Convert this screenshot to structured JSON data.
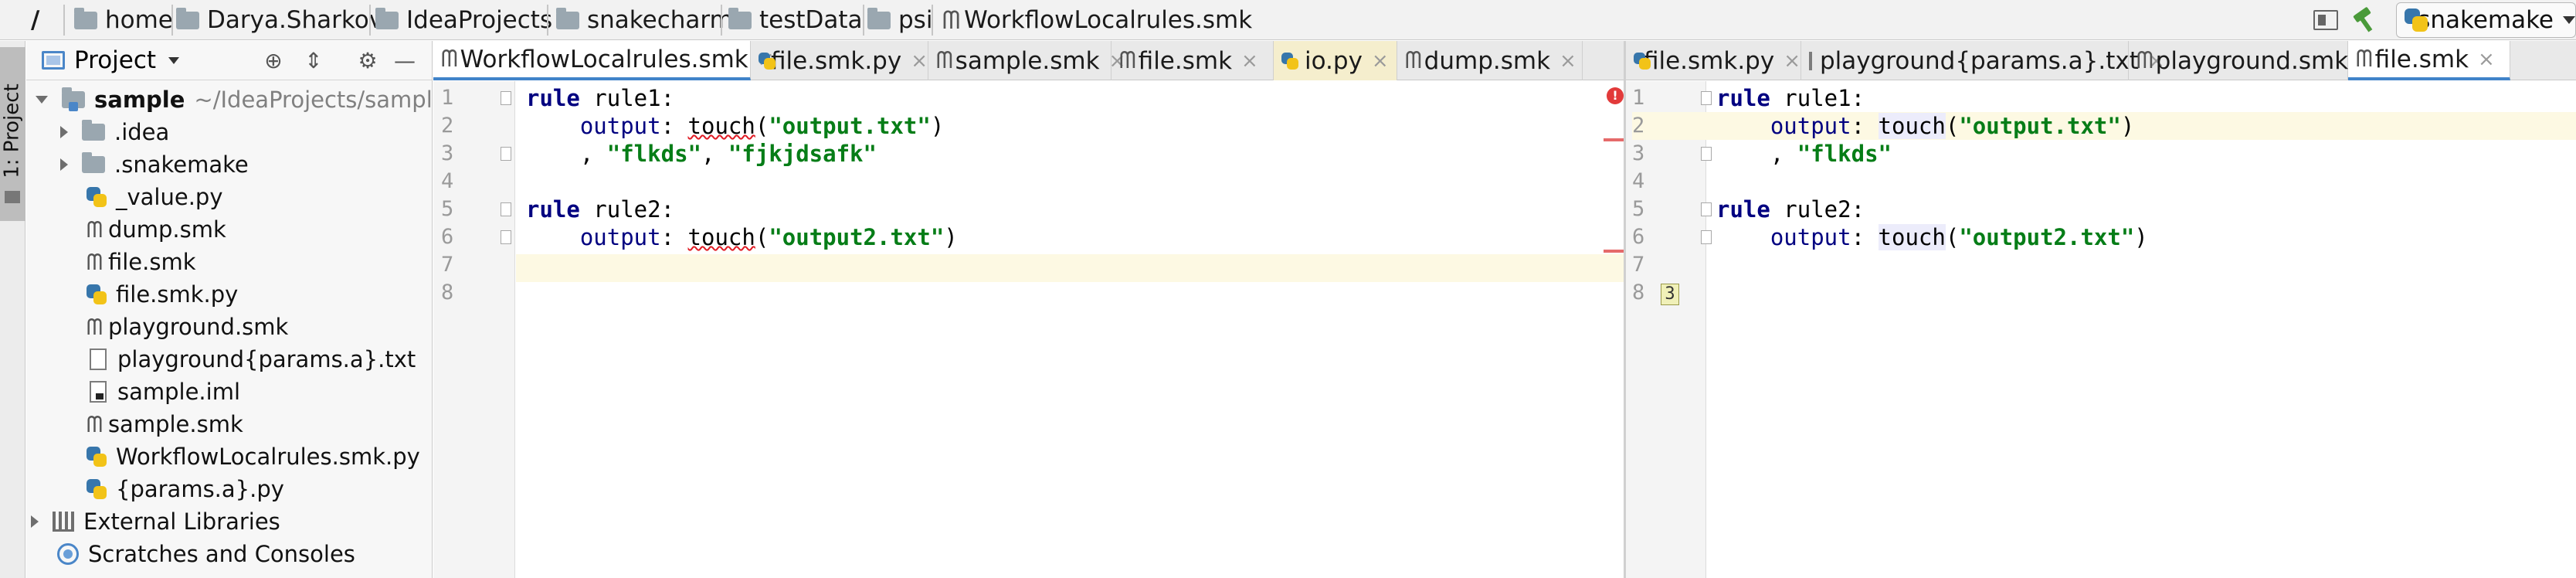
{
  "navbar": {
    "root": "/",
    "crumbs": [
      "home",
      "Darya.Sharkova",
      "IdeaProjects",
      "snakecharm",
      "testData",
      "psi"
    ],
    "current_file": "WorkflowLocalrules.smk",
    "run_config": "snakemake",
    "icons": [
      "folder-icon",
      "snakemake-file-icon",
      "build-hammer-icon",
      "layout-icon",
      "python-icon"
    ]
  },
  "toolstrip": {
    "label": "1: Project"
  },
  "project_panel": {
    "title": "Project",
    "tree": [
      {
        "label": "sample",
        "path": "~/IdeaProjects/sample",
        "icon": "module-folder-icon",
        "expanded": true
      },
      {
        "label": ".idea",
        "icon": "folder-icon",
        "collapsed": true
      },
      {
        "label": ".snakemake",
        "icon": "folder-icon",
        "collapsed": true
      },
      {
        "label": "_value.py",
        "icon": "python-file-icon"
      },
      {
        "label": "dump.smk",
        "icon": "snakemake-file-icon"
      },
      {
        "label": "file.smk",
        "icon": "snakemake-file-icon"
      },
      {
        "label": "file.smk.py",
        "icon": "python-file-icon"
      },
      {
        "label": "playground.smk",
        "icon": "snakemake-file-icon"
      },
      {
        "label": "playground{params.a}.txt",
        "icon": "text-file-icon"
      },
      {
        "label": "sample.iml",
        "icon": "iml-file-icon"
      },
      {
        "label": "sample.smk",
        "icon": "snakemake-file-icon"
      },
      {
        "label": "WorkflowLocalrules.smk.py",
        "icon": "python-file-icon"
      },
      {
        "label": "{params.a}.py",
        "icon": "python-file-icon"
      },
      {
        "label": "External Libraries",
        "icon": "libraries-icon",
        "collapsed": true
      },
      {
        "label": "Scratches and Consoles",
        "icon": "scratches-icon"
      }
    ]
  },
  "left_editor": {
    "tabs": [
      {
        "label": "WorkflowLocalrules.smk",
        "active": true
      },
      {
        "label": "file.smk.py"
      },
      {
        "label": "sample.smk"
      },
      {
        "label": "file.smk"
      },
      {
        "label": "io.py"
      },
      {
        "label": "dump.smk"
      }
    ],
    "line_numbers": [
      "1",
      "2",
      "3",
      "4",
      "5",
      "6",
      "7",
      "8"
    ],
    "lines": [
      [
        "rule",
        " rule1:"
      ],
      [
        "    output",
        ": ",
        "touch",
        "(",
        "\"output.txt\"",
        ")"
      ],
      [
        "    , ",
        "\"flkds\"",
        ", ",
        "\"fjkjdsafk\""
      ],
      [
        ""
      ],
      [
        "rule",
        " rule2:"
      ],
      [
        "    output",
        ": ",
        "touch",
        "(",
        "\"output2.txt\"",
        ")"
      ],
      [
        ""
      ],
      [
        ""
      ]
    ],
    "error_marker": "!"
  },
  "right_editor": {
    "tabs": [
      {
        "label": "file.smk.py"
      },
      {
        "label": "playground{params.a}.txt"
      },
      {
        "label": "playground.smk"
      },
      {
        "label": "file.smk",
        "active": true
      }
    ],
    "line_numbers": [
      "1",
      "2",
      "3",
      "4",
      "5",
      "6",
      "7",
      "8"
    ],
    "lines": [
      [
        "rule",
        " rule1:"
      ],
      [
        "    output",
        ": ",
        "touch",
        "(",
        "\"output.txt\"",
        ")"
      ],
      [
        "    , ",
        "\"flkds\""
      ],
      [
        ""
      ],
      [
        "rule",
        " rule2:"
      ],
      [
        "    output",
        ": ",
        "touch",
        "(",
        "\"output2.txt\"",
        ")"
      ],
      [
        ""
      ],
      [
        ""
      ]
    ],
    "badge": "3"
  },
  "colors": {
    "keyword": "#000080",
    "string": "#067d17",
    "current_line": "#fdf9e3",
    "active_tab_underline": "#4083c9",
    "error": "#e23a3a"
  }
}
